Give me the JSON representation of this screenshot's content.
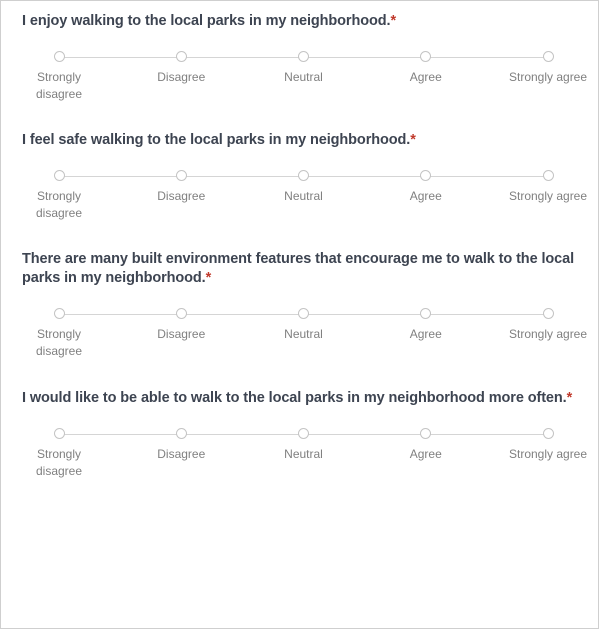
{
  "form": {
    "required_marker": "*",
    "colors": {
      "question_text": "#3d4451",
      "required_asterisk": "#c0392b",
      "option_label": "#808080",
      "track": "#d5d5d5",
      "circle_border": "#c4c4c4",
      "card_border": "#cfcfcf",
      "background": "#ffffff"
    },
    "scale_options": [
      {
        "label": "Strongly disagree",
        "value": "strongly-disagree",
        "wrap": true
      },
      {
        "label": "Disagree",
        "value": "disagree",
        "wrap": false
      },
      {
        "label": "Neutral",
        "value": "neutral",
        "wrap": false
      },
      {
        "label": "Agree",
        "value": "agree",
        "wrap": false
      },
      {
        "label": "Strongly agree",
        "value": "strongly-agree",
        "wrap": false
      }
    ],
    "questions": [
      {
        "id": "q1",
        "text": "I enjoy walking to the local parks in my neighborhood.",
        "required": true,
        "selected": null
      },
      {
        "id": "q2",
        "text": "I feel safe walking to the local parks in my neighborhood.",
        "required": true,
        "selected": null
      },
      {
        "id": "q3",
        "text": "There are many built environment features that encourage me to walk to the local parks in my neighborhood.",
        "required": true,
        "selected": null
      },
      {
        "id": "q4",
        "text": "I would like to be able to walk to the local parks in my neighborhood more often.",
        "required": true,
        "selected": null
      }
    ]
  }
}
